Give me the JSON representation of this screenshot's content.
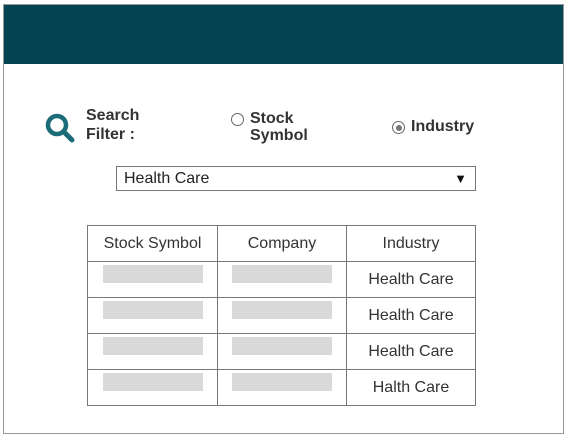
{
  "search": {
    "label": "Search Filter :",
    "icon": "search-icon",
    "accent_color": "#1c6b78"
  },
  "header": {
    "color": "#034452"
  },
  "filter_options": [
    {
      "label": "Stock Symbol",
      "selected": false
    },
    {
      "label": "Industry",
      "selected": true
    }
  ],
  "dropdown": {
    "selected_value": "Health Care",
    "arrow": "▼"
  },
  "table": {
    "columns": [
      "Stock Symbol",
      "Company",
      "Industry"
    ],
    "rows": [
      {
        "industry": "Health Care"
      },
      {
        "industry": "Health Care"
      },
      {
        "industry": "Health Care"
      },
      {
        "industry": "Halth Care"
      }
    ]
  }
}
